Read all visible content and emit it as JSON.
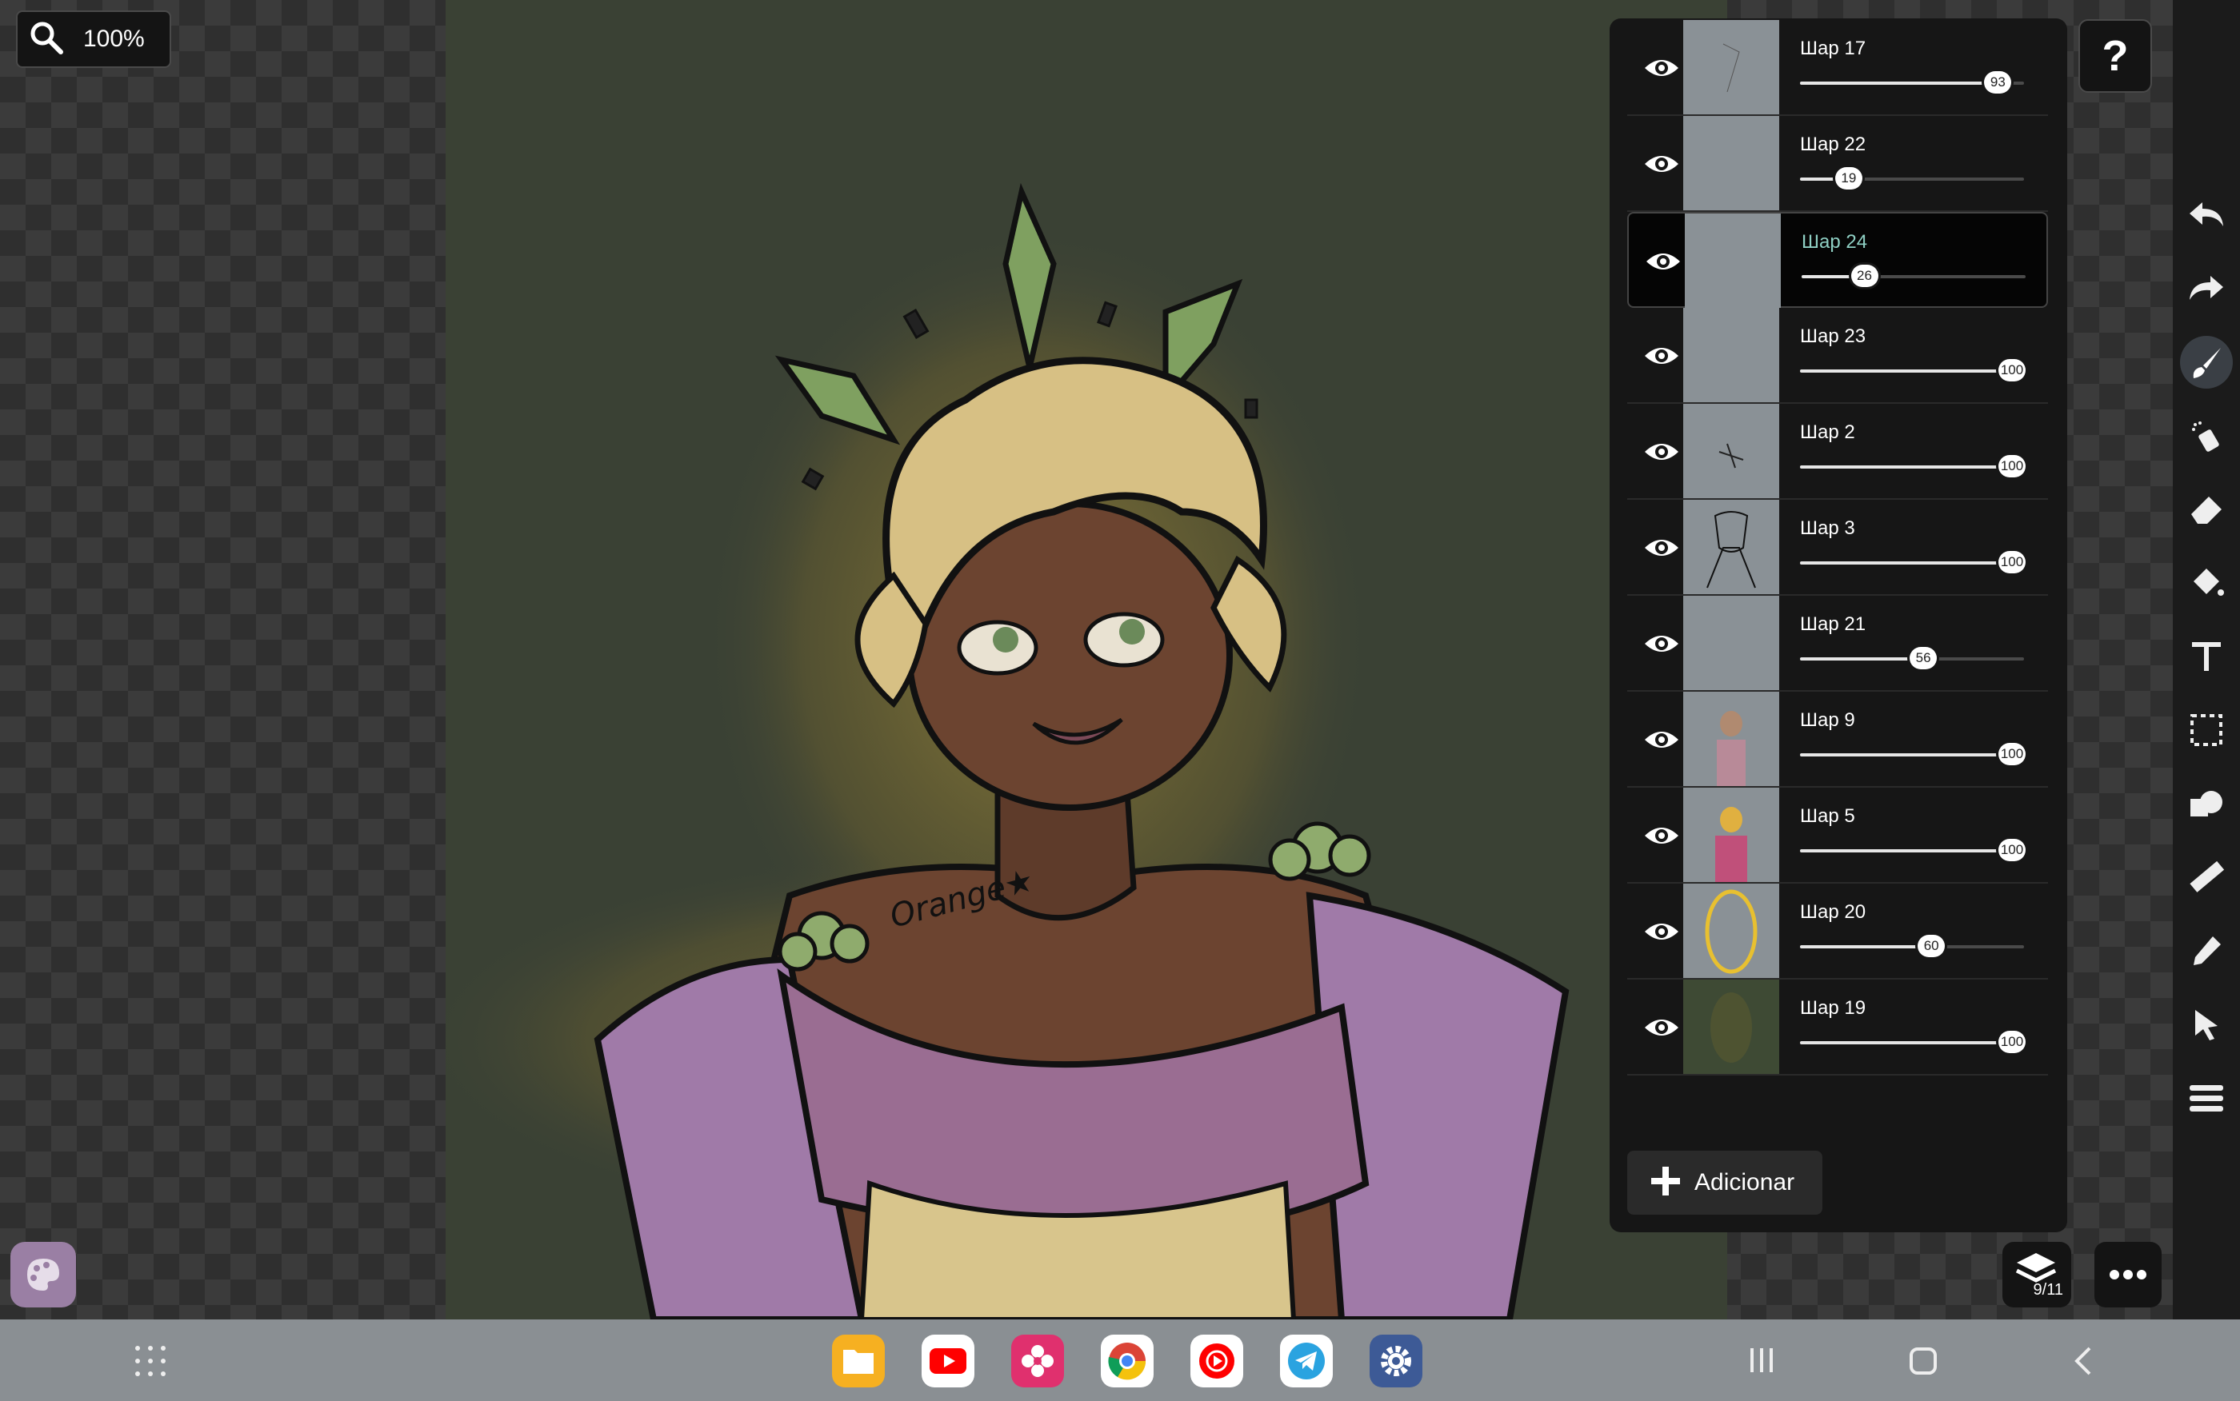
{
  "app": {
    "zoom_label": "100%",
    "help_label": "?",
    "layer_count": "9/11",
    "signature_text": "Orange★"
  },
  "layers_panel": {
    "add_label": "Adicionar",
    "selected_index": 2,
    "items": [
      {
        "name": "Шар 17",
        "opacity": 93
      },
      {
        "name": "Шар 22",
        "opacity": 19
      },
      {
        "name": "Шар 24",
        "opacity": 26
      },
      {
        "name": "Шар 23",
        "opacity": 100
      },
      {
        "name": "Шар 2",
        "opacity": 100
      },
      {
        "name": "Шар 3",
        "opacity": 100
      },
      {
        "name": "Шар 21",
        "opacity": 56
      },
      {
        "name": "Шар 9",
        "opacity": 100
      },
      {
        "name": "Шар 5",
        "opacity": 100
      },
      {
        "name": "Шар 20",
        "opacity": 60
      },
      {
        "name": "Шар 19",
        "opacity": 100
      }
    ]
  },
  "toolbar": {
    "tools": [
      "undo-icon",
      "redo-icon",
      "brush-icon",
      "spray-icon",
      "eraser-icon",
      "fill-bucket-icon",
      "text-icon",
      "selection-icon",
      "shapes-icon",
      "ruler-icon",
      "eyedropper-icon",
      "pointer-icon",
      "menu-list-icon"
    ],
    "active_tool": "brush-icon"
  },
  "taskbar": {
    "apps": [
      "files-icon",
      "youtube-icon",
      "gallery-icon",
      "chrome-icon",
      "youtube-music-icon",
      "telegram-icon",
      "settings-icon"
    ]
  },
  "colors": {
    "canvas_bg": "#3a4134",
    "selected_layer_text": "#8fd0c4",
    "panel_bg": "#161616"
  }
}
